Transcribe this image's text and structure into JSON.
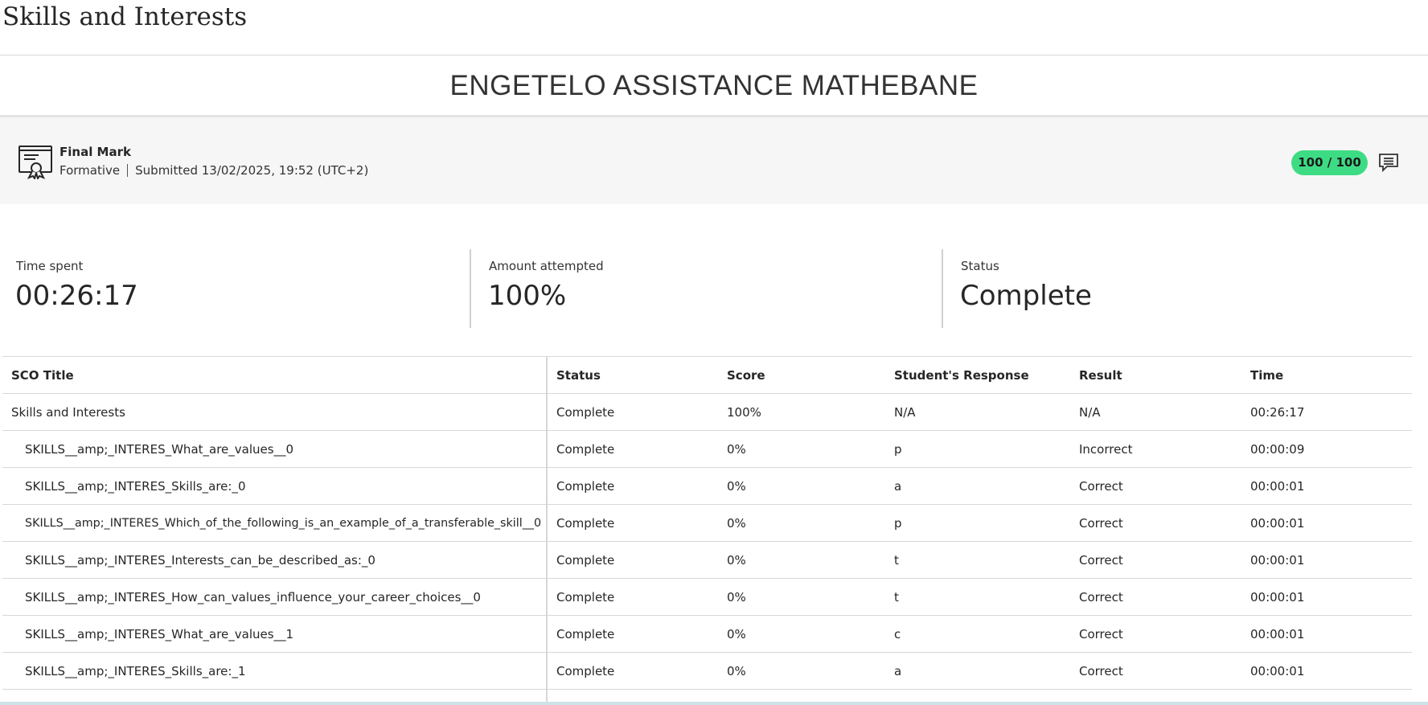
{
  "page": {
    "title": "Skills and Interests",
    "student_name": "ENGETELO ASSISTANCE MATHEBANE"
  },
  "final_mark": {
    "icon": "certificate-icon",
    "label": "Final Mark",
    "type": "Formative",
    "submitted": "Submitted 13/02/2025, 19:52 (UTC+2)",
    "score": "100 / 100",
    "score_color": "#3ddc84",
    "comment_icon": "comment-icon"
  },
  "stats": [
    {
      "label": "Time spent",
      "value": "00:26:17"
    },
    {
      "label": "Amount attempted",
      "value": "100%"
    },
    {
      "label": "Status",
      "value": "Complete"
    }
  ],
  "table": {
    "headers": [
      "SCO Title",
      "Status",
      "Score",
      "Student's Response",
      "Result",
      "Time"
    ],
    "rows": [
      {
        "title": "Skills and Interests",
        "status": "Complete",
        "score": "100%",
        "response": "N/A",
        "result": "N/A",
        "time": "00:26:17"
      },
      {
        "title": "SKILLS__amp;_INTERES_What_are_values__0",
        "status": "Complete",
        "score": "0%",
        "response": "p",
        "result": "Incorrect",
        "time": "00:00:09"
      },
      {
        "title": "SKILLS__amp;_INTERES_Skills_are:_0",
        "status": "Complete",
        "score": "0%",
        "response": "a",
        "result": "Correct",
        "time": "00:00:01"
      },
      {
        "title": "SKILLS__amp;_INTERES_Which_of_the_following_is_an_example_of_a_transferable_skill__0",
        "status": "Complete",
        "score": "0%",
        "response": "p",
        "result": "Correct",
        "time": "00:00:01"
      },
      {
        "title": "SKILLS__amp;_INTERES_Interests_can_be_described_as:_0",
        "status": "Complete",
        "score": "0%",
        "response": "t",
        "result": "Correct",
        "time": "00:00:01"
      },
      {
        "title": "SKILLS__amp;_INTERES_How_can_values_influence_your_career_choices__0",
        "status": "Complete",
        "score": "0%",
        "response": "t",
        "result": "Correct",
        "time": "00:00:01"
      },
      {
        "title": "SKILLS__amp;_INTERES_What_are_values__1",
        "status": "Complete",
        "score": "0%",
        "response": "c",
        "result": "Correct",
        "time": "00:00:01"
      },
      {
        "title": "SKILLS__amp;_INTERES_Skills_are:_1",
        "status": "Complete",
        "score": "0%",
        "response": "a",
        "result": "Correct",
        "time": "00:00:01"
      }
    ]
  }
}
